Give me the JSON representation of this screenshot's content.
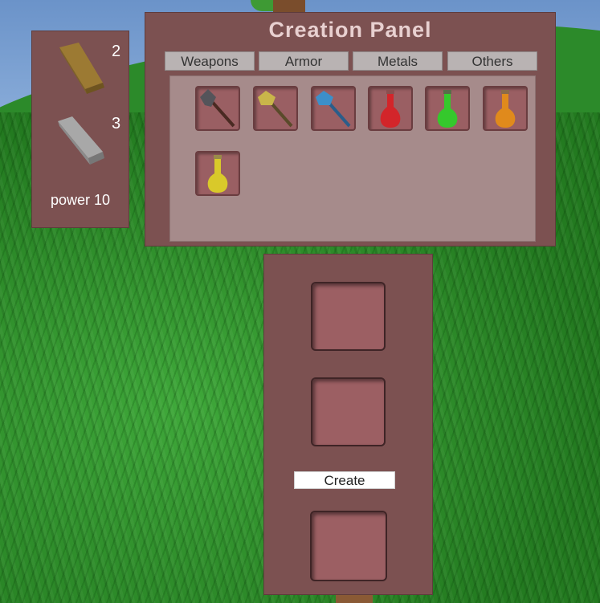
{
  "inventory": {
    "items": [
      {
        "name": "wood-plank",
        "count": "2"
      },
      {
        "name": "stone-slab",
        "count": "3"
      }
    ],
    "power_label": "power 10"
  },
  "creation_panel": {
    "title": "Creation Panel",
    "tabs": [
      "Weapons",
      "Armor",
      "Metals",
      "Others"
    ],
    "items": [
      {
        "icon": "dark-axe-icon",
        "color": "#54545a"
      },
      {
        "icon": "gold-axe-icon",
        "color": "#c9b64a"
      },
      {
        "icon": "blue-axe-icon",
        "color": "#3c8fc9"
      },
      {
        "icon": "red-potion-icon",
        "color": "#d3252a"
      },
      {
        "icon": "green-potion-icon",
        "color": "#35c82c"
      },
      {
        "icon": "orange-potion-icon",
        "color": "#e08a1c"
      },
      {
        "icon": "yellow-potion-icon",
        "color": "#d9c92a"
      }
    ]
  },
  "crafting": {
    "create_label": "Create"
  },
  "colors": {
    "panel": "#7c5151",
    "panel_inner": "#a68b8b",
    "slot": "#9a5f63"
  }
}
